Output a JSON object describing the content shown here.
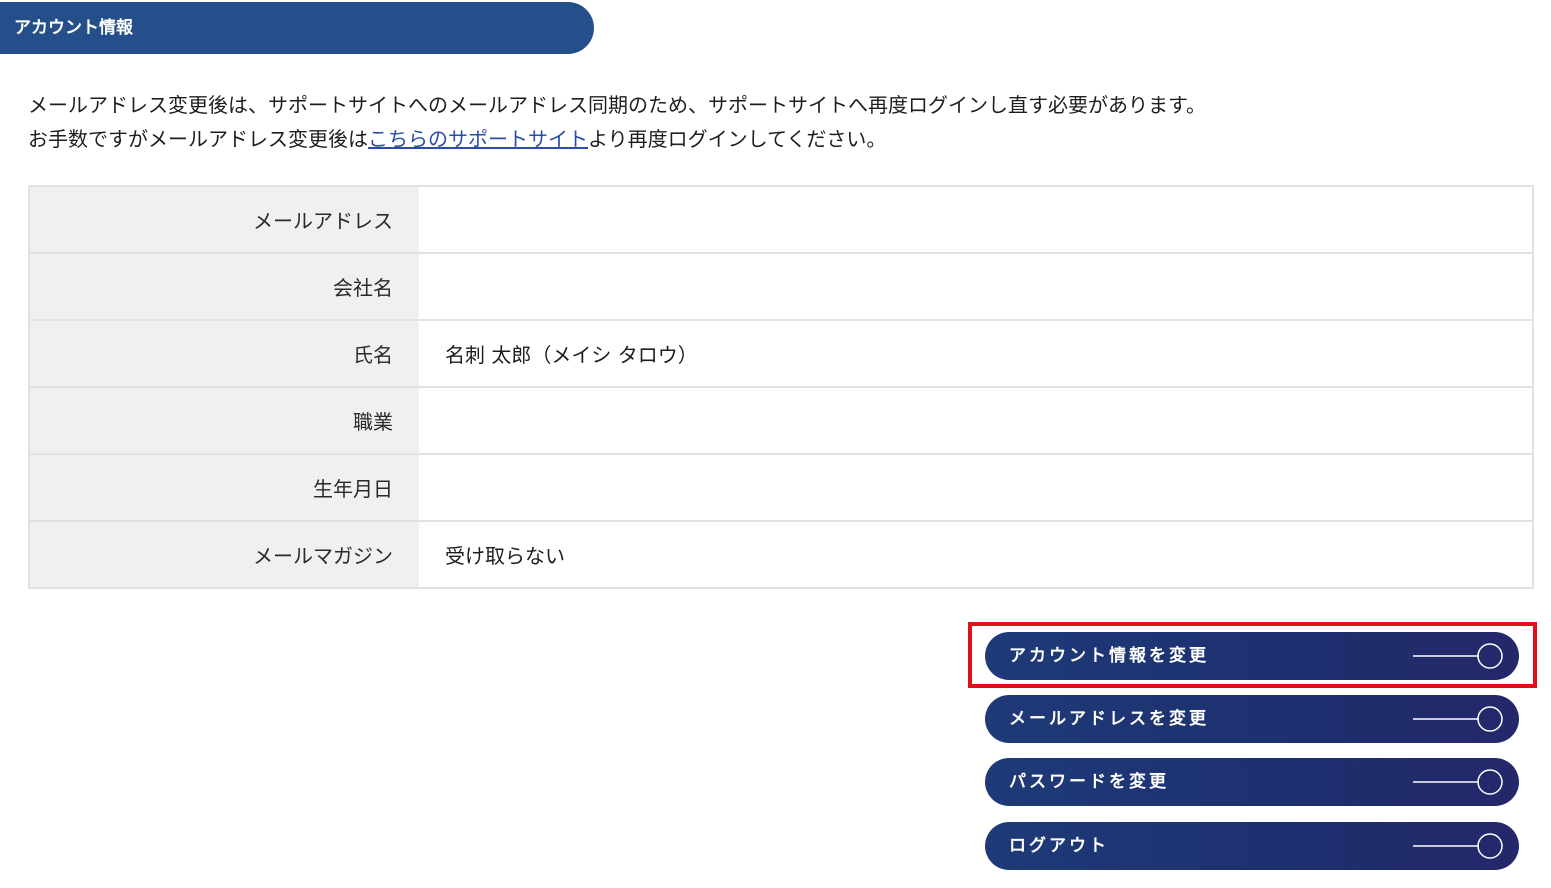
{
  "header": {
    "title": "アカウント情報"
  },
  "notice": {
    "line1": "メールアドレス変更後は、サポートサイトへのメールアドレス同期のため、サポートサイトへ再度ログインし直す必要があります。",
    "line2_before": "お手数ですがメールアドレス変更後は",
    "line2_link": "こちらのサポートサイト",
    "line2_after": "より再度ログインしてください。"
  },
  "table": {
    "rows": [
      {
        "label": "メールアドレス",
        "value": ""
      },
      {
        "label": "会社名",
        "value": ""
      },
      {
        "label": "氏名",
        "value": "名刺 太郎（メイシ タロウ）"
      },
      {
        "label": "職業",
        "value": ""
      },
      {
        "label": "生年月日",
        "value": ""
      },
      {
        "label": "メールマガジン",
        "value": "受け取らない"
      }
    ]
  },
  "buttons": {
    "change_account": "アカウント情報を変更",
    "change_email": "メールアドレスを変更",
    "change_password": "パスワードを変更",
    "logout": "ログアウト"
  },
  "icons": {
    "button_arrow": "line-circle-arrow-icon"
  },
  "colors": {
    "header_bg": "#244f8a",
    "button_bg": "#1d2f6e",
    "highlight": "#e10f1a",
    "link": "#2a4da8"
  }
}
